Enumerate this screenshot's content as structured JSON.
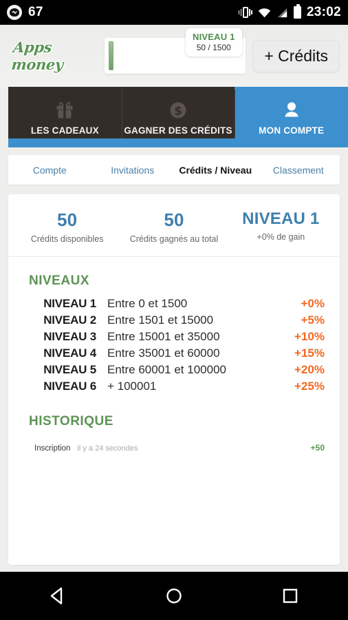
{
  "statusbar": {
    "notification_icon": "messenger-icon",
    "notification_count": "67",
    "icons": [
      "vibrate-icon",
      "wifi-icon",
      "signal-icon",
      "battery-icon"
    ],
    "clock": "23:02"
  },
  "header": {
    "logo_text": "Apps money",
    "progress_percent": 3.3,
    "badge": {
      "level": "NIVEAU 1",
      "progress": "50 / 1500"
    },
    "credits_button": "+ Crédits"
  },
  "main_tabs": [
    {
      "label": "LES CADEAUX",
      "icon": "gift-icon",
      "active": false
    },
    {
      "label": "GAGNER DES CRÉDITS",
      "icon": "dollar-coin-icon",
      "active": false
    },
    {
      "label": "MON COMPTE",
      "icon": "person-icon",
      "active": true
    }
  ],
  "sub_tabs": [
    {
      "label": "Compte",
      "active": false
    },
    {
      "label": "Invitations",
      "active": false
    },
    {
      "label": "Crédits / Niveau",
      "active": true
    },
    {
      "label": "Classement",
      "active": false
    }
  ],
  "stats": [
    {
      "value": "50",
      "label": "Crédits disponibles"
    },
    {
      "value": "50",
      "label": "Crédits gagnés au total"
    },
    {
      "value": "NIVEAU 1",
      "label": "+0% de gain"
    }
  ],
  "levels_section": {
    "heading": "NIVEAUX",
    "rows": [
      {
        "name": "NIVEAU 1",
        "range": "Entre 0 et 1500",
        "bonus": "+0%"
      },
      {
        "name": "NIVEAU 2",
        "range": "Entre 1501 et 15000",
        "bonus": "+5%"
      },
      {
        "name": "NIVEAU 3",
        "range": "Entre 15001 et 35000",
        "bonus": "+10%"
      },
      {
        "name": "NIVEAU 4",
        "range": "Entre 35001 et 60000",
        "bonus": "+15%"
      },
      {
        "name": "NIVEAU 5",
        "range": "Entre 60001 et 100000",
        "bonus": "+20%"
      },
      {
        "name": "NIVEAU 6",
        "range": "+ 100001",
        "bonus": "+25%"
      }
    ]
  },
  "history_section": {
    "heading": "HISTORIQUE",
    "rows": [
      {
        "title": "Inscription",
        "time": "il y a 24 secondes",
        "amount": "+50"
      }
    ]
  },
  "navbar": {
    "back": "back-triangle-icon",
    "home": "home-circle-icon",
    "recent": "recent-square-icon"
  },
  "colors": {
    "accent_blue": "#3d90ce",
    "green": "#5c9455",
    "orange": "#f2681f",
    "dark_tab": "#332d2a",
    "stat_blue": "#3f7fad",
    "page_bg": "#eeeeec"
  }
}
